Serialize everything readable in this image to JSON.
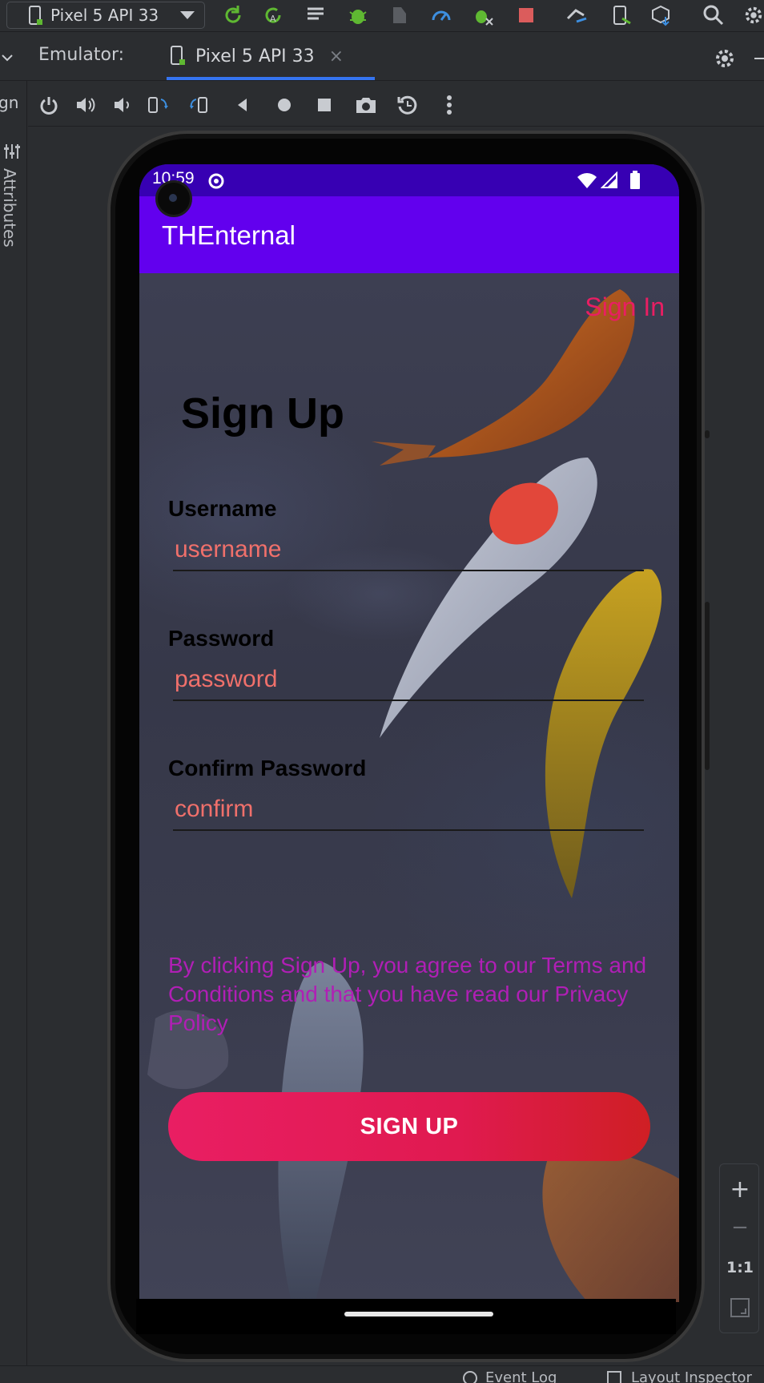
{
  "ide": {
    "device_selector": "Pixel 5 API 33",
    "emulator_label": "Emulator:",
    "emulator_tab": "Pixel 5 API 33",
    "tab_close": "×",
    "side_label_partial": "gn",
    "attributes_label": "Attributes",
    "bottom_items": [
      "Event Log",
      "Layout Inspector"
    ],
    "zoom": {
      "plus": "+",
      "minus": "−",
      "one_to_one": "1:1"
    }
  },
  "device": {
    "status_time": "10:59",
    "app_title": "THEnternal"
  },
  "screen": {
    "signin_link": "Sign In",
    "heading": "Sign Up",
    "fields": [
      {
        "label": "Username",
        "placeholder": "username"
      },
      {
        "label": "Password",
        "placeholder": "password"
      },
      {
        "label": "Confirm Password",
        "placeholder": "confirm"
      }
    ],
    "terms_text": "By clicking Sign Up, you agree to our Terms and Conditions and that you have read our Privacy Policy",
    "signup_button": "SIGN UP"
  },
  "colors": {
    "status_bar": "#3700b3",
    "app_bar": "#6200ee",
    "accent_pink": "#e91e63",
    "terms_purple": "#b01fb5",
    "placeholder_coral": "#f0706b"
  }
}
